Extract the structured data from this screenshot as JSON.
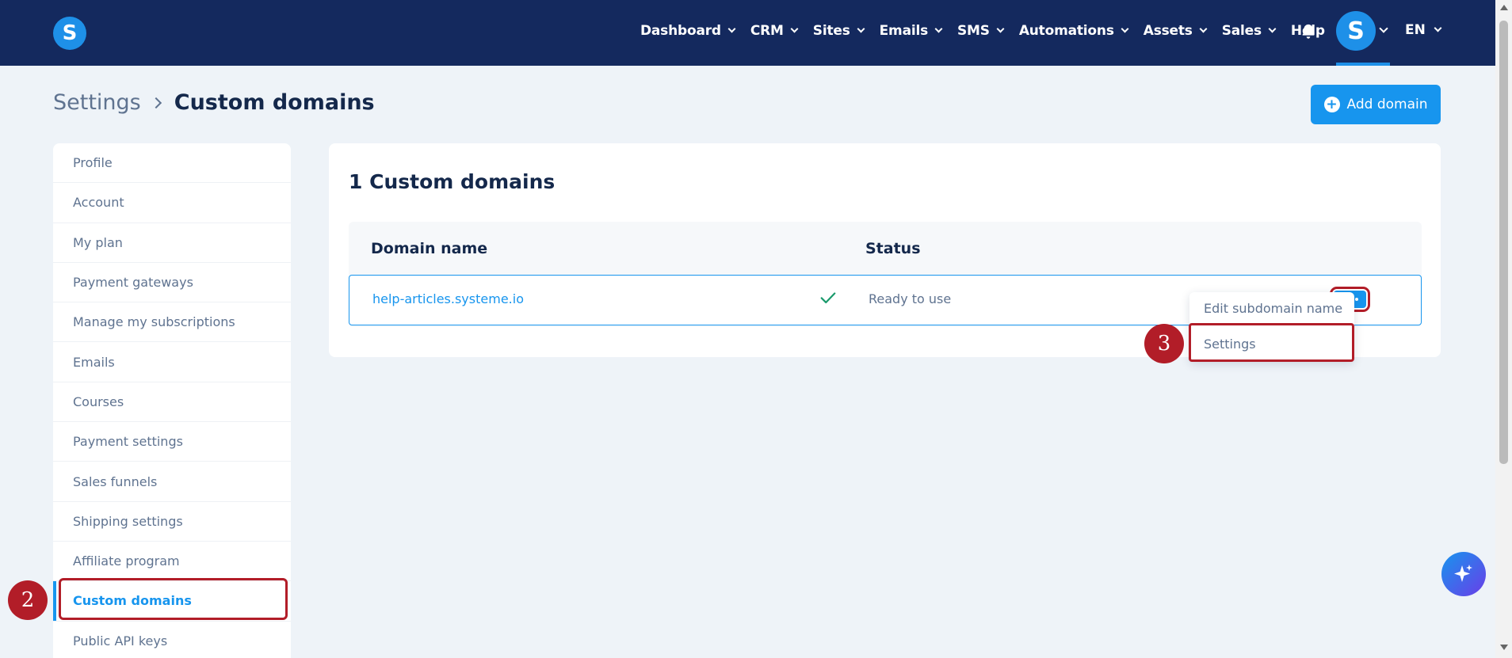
{
  "nav": {
    "logo_letter": "S",
    "items": [
      {
        "label": "Dashboard",
        "chevron": true
      },
      {
        "label": "CRM",
        "chevron": true
      },
      {
        "label": "Sites",
        "chevron": true
      },
      {
        "label": "Emails",
        "chevron": true
      },
      {
        "label": "SMS",
        "chevron": true
      },
      {
        "label": "Automations",
        "chevron": true
      },
      {
        "label": "Assets",
        "chevron": true
      },
      {
        "label": "Sales",
        "chevron": true
      },
      {
        "label": "Help",
        "chevron": false
      }
    ],
    "avatar_letter": "S",
    "language": "EN"
  },
  "breadcrumb": {
    "parent": "Settings",
    "current": "Custom domains"
  },
  "add_domain_label": "Add domain",
  "sidebar": {
    "items": [
      {
        "label": "Profile"
      },
      {
        "label": "Account"
      },
      {
        "label": "My plan"
      },
      {
        "label": "Payment gateways"
      },
      {
        "label": "Manage my subscriptions"
      },
      {
        "label": "Emails"
      },
      {
        "label": "Courses"
      },
      {
        "label": "Payment settings"
      },
      {
        "label": "Sales funnels"
      },
      {
        "label": "Shipping settings"
      },
      {
        "label": "Affiliate program"
      },
      {
        "label": "Custom domains",
        "active": true
      },
      {
        "label": "Public API keys"
      }
    ]
  },
  "main": {
    "title": "1 Custom domains",
    "columns": {
      "domain": "Domain name",
      "status": "Status"
    },
    "rows": [
      {
        "domain": "help-articles.systeme.io",
        "status": "Ready to use"
      }
    ]
  },
  "dropdown": {
    "items": [
      "Edit subdomain name",
      "Settings"
    ]
  },
  "annotations": {
    "step_sidebar": "2",
    "step_dropdown": "3"
  },
  "colors": {
    "nav_bg": "#14295e",
    "accent": "#1795ee",
    "highlight": "#b21d28",
    "success": "#1a9a6c"
  }
}
